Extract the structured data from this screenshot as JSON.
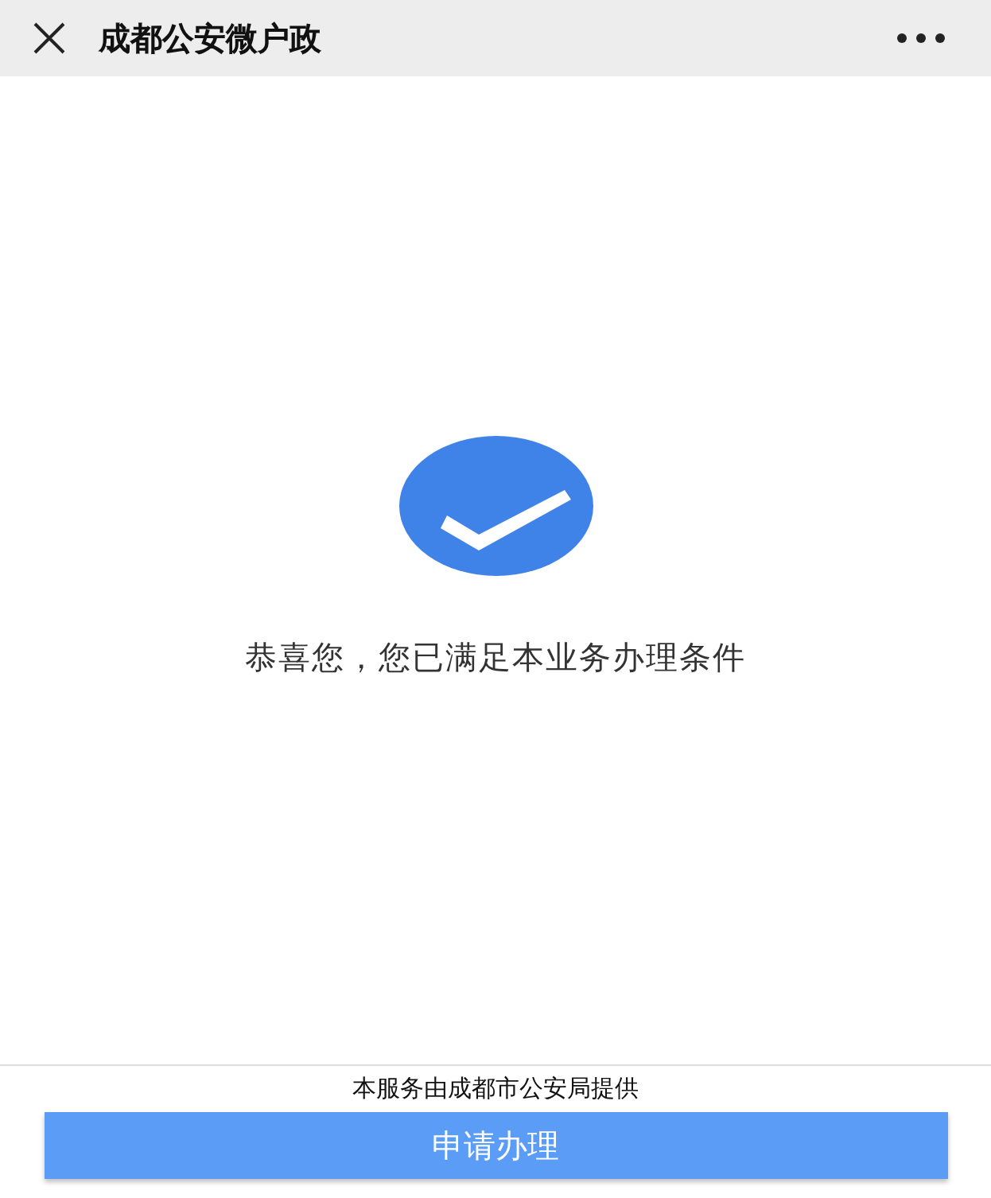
{
  "header": {
    "title": "成都公安微户政"
  },
  "result": {
    "message": "恭喜您，您已满足本业务办理条件"
  },
  "footer": {
    "provider": "本服务由成都市公安局提供",
    "button": "申请办理"
  }
}
